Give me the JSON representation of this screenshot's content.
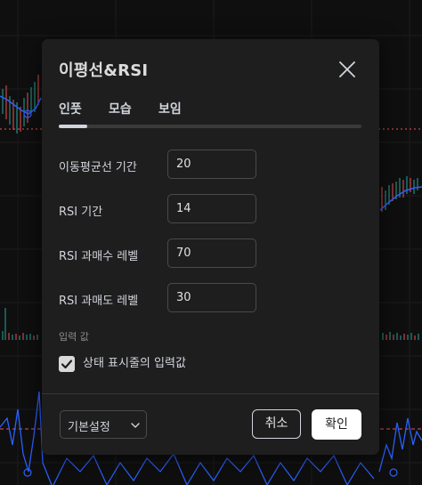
{
  "dialog": {
    "title": "이평선&RSI",
    "tabs": [
      {
        "label": "인풋",
        "active": true
      },
      {
        "label": "모습",
        "active": false
      },
      {
        "label": "보임",
        "active": false
      }
    ],
    "fields": [
      {
        "label": "이동평균선 기간",
        "value": "20"
      },
      {
        "label": "RSI 기간",
        "value": "14"
      },
      {
        "label": "RSI 과매수 레벨",
        "value": "70"
      },
      {
        "label": "RSI 과매도 레벨",
        "value": "30"
      }
    ],
    "input_section_label": "입력 값",
    "status_line_checkbox": {
      "label": "상태 표시줄의 입력값",
      "checked": true
    },
    "preset": {
      "label": "기본설정"
    },
    "buttons": {
      "cancel": "취소",
      "ok": "확인"
    }
  },
  "icons": {
    "close": "close-icon",
    "chevron": "chevron-down-icon",
    "check": "checkmark-icon"
  },
  "colors": {
    "dialog_bg": "#1e1e1e",
    "page_bg": "#0f0f10",
    "text": "#d1d4dc",
    "ok_button_bg": "#ffffff",
    "candle_up": "#26a69a",
    "candle_down": "#ef5350",
    "ma_line": "#2962ff",
    "rsi_line": "#2962ff"
  }
}
